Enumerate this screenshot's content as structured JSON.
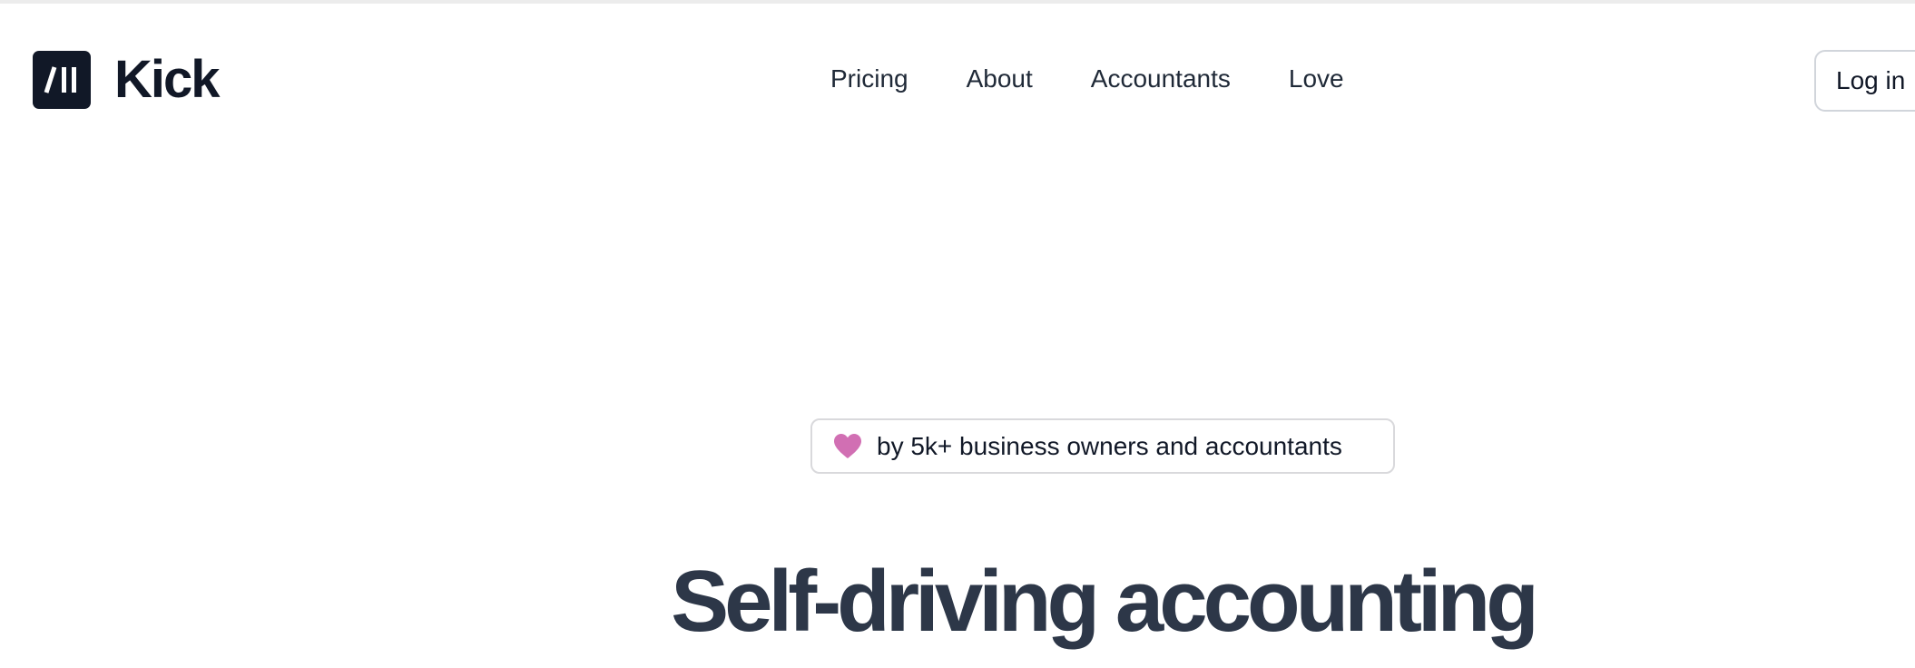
{
  "header": {
    "logo_text": "Kick",
    "nav": [
      {
        "label": "Pricing"
      },
      {
        "label": "About"
      },
      {
        "label": "Accountants"
      },
      {
        "label": "Love"
      }
    ],
    "login_label": "Log in"
  },
  "hero": {
    "badge": {
      "icon": "heart-icon",
      "text": "by 5k+ business owners and accountants"
    },
    "title": "Self-driving accounting"
  },
  "colors": {
    "logo_bg": "#111827",
    "heart": "#d16fb3",
    "title": "#2d3748",
    "border": "#d1d5db"
  }
}
